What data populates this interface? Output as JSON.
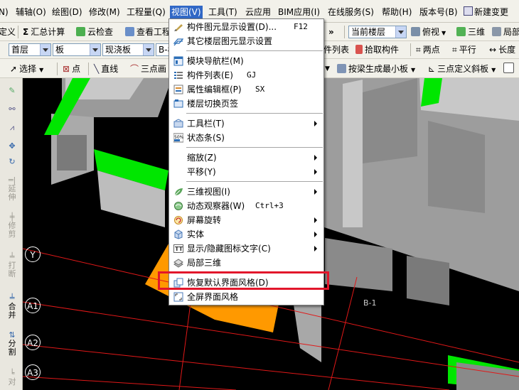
{
  "menubar": {
    "items": [
      {
        "label": "N)"
      },
      {
        "label": "辅轴(O)"
      },
      {
        "label": "绘图(D)"
      },
      {
        "label": "修改(M)"
      },
      {
        "label": "工程量(Q)"
      },
      {
        "label": "视图(V)"
      },
      {
        "label": "工具(T)"
      },
      {
        "label": "云应用"
      },
      {
        "label": "BIM应用(I)"
      },
      {
        "label": "在线服务(S)"
      },
      {
        "label": "帮助(H)"
      },
      {
        "label": "版本号(B)"
      },
      {
        "label": "新建变更"
      }
    ]
  },
  "toolbar1": {
    "define_label": "定义",
    "sum_calc_label": "汇总计算",
    "cloud_check_label": "云检查",
    "view_project_label": "查看工程",
    "current_floor_label": "当前楼层",
    "topview_label": "俯视",
    "three_d_label": "三维",
    "local_label": "局部"
  },
  "toolbar2": {
    "floor_value": "首层",
    "element_type_value": "板",
    "element_name_value": "现浇板",
    "element_id_value": "B-8",
    "component_list_label": "件列表",
    "pick_component_label": "拾取构件",
    "two_point_label": "两点",
    "parallel_label": "平行",
    "length_label": "长度"
  },
  "toolbar3": {
    "select_label": "选择",
    "point_label": "点",
    "line_label": "直线",
    "three_point_arc_label": "三点画",
    "beam_slab_label": "按梁生成最小板",
    "three_point_slope_label": "三点定义斜板"
  },
  "left_tools": {
    "extend_label": "延伸",
    "trim_label": "修剪",
    "break_label": "打断",
    "merge_label": "合并",
    "split_label": "分割",
    "align_label": "对"
  },
  "canvas": {
    "axis_labels": [
      "Y",
      "A1",
      "A2",
      "A3"
    ],
    "slab_label": "B-1"
  },
  "view_menu": {
    "items": [
      {
        "label": "构件图元显示设置(D)...",
        "shortcut": "F12",
        "icon": "component-display-icon"
      },
      {
        "label": "其它楼层图元显示设置",
        "shortcut": "",
        "icon": "other-floor-display-icon"
      },
      {
        "label": "模块导航栏(M)",
        "shortcut": "",
        "icon": "module-nav-icon"
      },
      {
        "label": "构件列表(E)",
        "shortcut": "GJ",
        "icon": "component-list-icon"
      },
      {
        "label": "属性编辑框(P)",
        "shortcut": "SX",
        "icon": "property-editor-icon"
      },
      {
        "label": "楼层切换页签",
        "shortcut": "",
        "icon": "floor-tab-icon"
      },
      {
        "label": "工具栏(T)",
        "shortcut": "",
        "icon": "toolbar-icon"
      },
      {
        "label": "状态条(S)",
        "shortcut": "",
        "icon": "statusbar-icon"
      },
      {
        "label": "缩放(Z)",
        "shortcut": "",
        "icon": ""
      },
      {
        "label": "平移(Y)",
        "shortcut": "",
        "icon": ""
      },
      {
        "label": "三维视图(I)",
        "shortcut": "",
        "icon": "three-d-view-icon"
      },
      {
        "label": "动态观察器(W)",
        "shortcut": "Ctrl+3",
        "icon": "dynamic-observer-icon"
      },
      {
        "label": "屏幕旋转",
        "shortcut": "",
        "icon": "screen-rotate-icon"
      },
      {
        "label": "实体",
        "shortcut": "",
        "icon": "solid-icon"
      },
      {
        "label": "显示/隐藏图标文字(C)",
        "shortcut": "",
        "icon": "icon-text-toggle-icon"
      },
      {
        "label": "局部三维",
        "shortcut": "",
        "icon": "local-3d-icon"
      },
      {
        "label": "恢复默认界面风格(D)",
        "shortcut": "",
        "icon": "restore-style-icon"
      },
      {
        "label": "全屏界面风格",
        "shortcut": "",
        "icon": "fullscreen-style-icon"
      }
    ]
  },
  "colors": {
    "menu_highlight": "#3168c6",
    "annotation_box": "#e2162b",
    "slab_green": "#00e600",
    "slab_orange": "#ff9900",
    "wall_gray": "#c0c0c0"
  }
}
